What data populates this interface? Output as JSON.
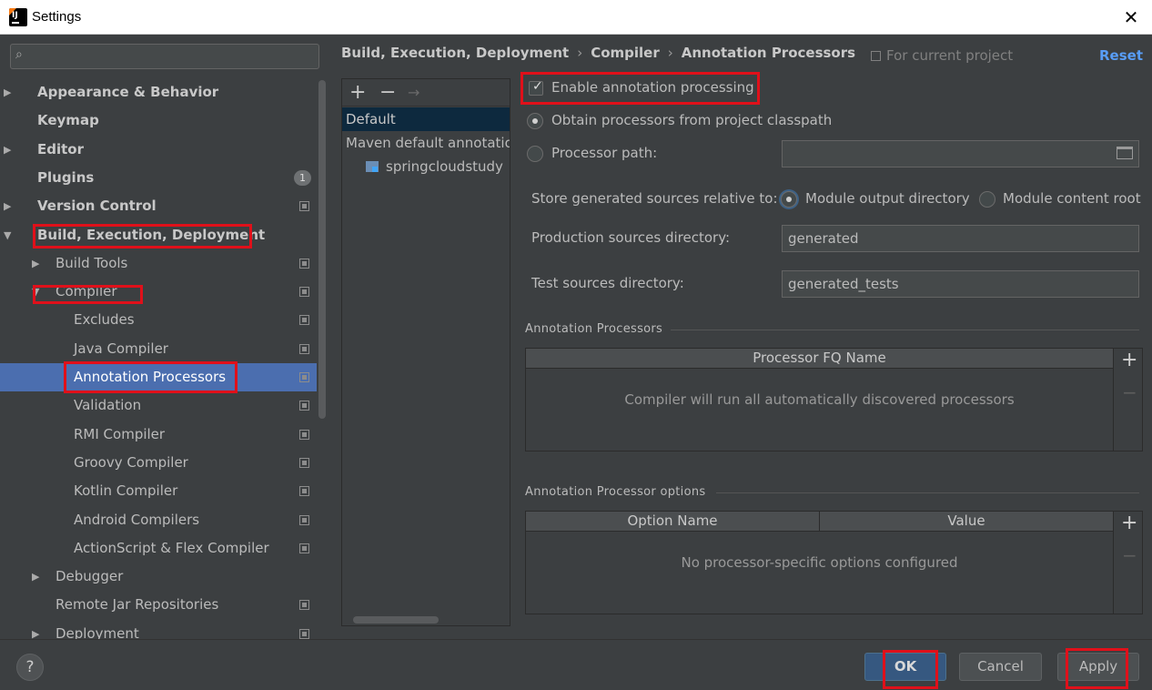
{
  "window": {
    "title": "Settings",
    "close_glyph": "✕",
    "app_icon": "intellij-idea-icon",
    "app_icon_text": "IJ"
  },
  "search": {
    "placeholder": "",
    "icon": "search-icon",
    "glyph": "⌕"
  },
  "sidebar": {
    "items": [
      {
        "label": "Appearance & Behavior",
        "level": 0,
        "arrow": "▶",
        "bold": true
      },
      {
        "label": "Keymap",
        "level": 0,
        "bold": true
      },
      {
        "label": "Editor",
        "level": 0,
        "arrow": "▶",
        "bold": true
      },
      {
        "label": "Plugins",
        "level": 0,
        "bold": true,
        "badge": "1"
      },
      {
        "label": "Version Control",
        "level": 0,
        "arrow": "▶",
        "bold": true,
        "project": true
      },
      {
        "label": "Build, Execution, Deployment",
        "level": 0,
        "arrow": "▼",
        "bold": true
      },
      {
        "label": "Build Tools",
        "level": 1,
        "arrow": "▶",
        "project": true
      },
      {
        "label": "Compiler",
        "level": 1,
        "arrow": "▼",
        "project": true
      },
      {
        "label": "Excludes",
        "level": 2,
        "project": true
      },
      {
        "label": "Java Compiler",
        "level": 2,
        "project": true
      },
      {
        "label": "Annotation Processors",
        "level": 2,
        "project": true,
        "selected": true
      },
      {
        "label": "Validation",
        "level": 2,
        "project": true
      },
      {
        "label": "RMI Compiler",
        "level": 2,
        "project": true
      },
      {
        "label": "Groovy Compiler",
        "level": 2,
        "project": true
      },
      {
        "label": "Kotlin Compiler",
        "level": 2,
        "project": true
      },
      {
        "label": "Android Compilers",
        "level": 2,
        "project": true
      },
      {
        "label": "ActionScript & Flex Compiler",
        "level": 2,
        "project": true
      },
      {
        "label": "Debugger",
        "level": 1,
        "arrow": "▶"
      },
      {
        "label": "Remote Jar Repositories",
        "level": 1,
        "project": true
      },
      {
        "label": "Deployment",
        "level": 1,
        "arrow": "▶",
        "project": true
      }
    ]
  },
  "breadcrumb": {
    "parts": [
      "Build, Execution, Deployment",
      "Compiler",
      "Annotation Processors"
    ],
    "separator": "›"
  },
  "scope": {
    "label": "For current project"
  },
  "reset_label": "Reset",
  "profiles": {
    "toolbar": {
      "add": "+",
      "remove": "−",
      "move": "→"
    },
    "items": [
      {
        "label": "Default",
        "selected": true
      },
      {
        "label": "Maven default annotation processors profile"
      },
      {
        "label": "springcloudstudy",
        "module": true
      }
    ]
  },
  "settings": {
    "enable_label": "Enable annotation processing",
    "enable_checked": true,
    "check_glyph": "✓",
    "obtain_classpath": "Obtain processors from project classpath",
    "processor_path": "Processor path:",
    "processor_path_value": "",
    "store_label": "Store generated sources relative to:",
    "module_output": "Module output directory",
    "module_content": "Module content root",
    "production_label": "Production sources directory:",
    "production_value": "generated",
    "test_label": "Test sources directory:",
    "test_value": "generated_tests"
  },
  "processors_table": {
    "section": "Annotation Processors",
    "header": "Processor FQ Name",
    "empty": "Compiler will run all automatically discovered processors",
    "add": "+",
    "remove": "−"
  },
  "options_table": {
    "section": "Annotation Processor options",
    "col_name": "Option Name",
    "col_value": "Value",
    "empty": "No processor-specific options configured",
    "add": "+",
    "remove": "−"
  },
  "footer": {
    "help": "?",
    "ok": "OK",
    "cancel": "Cancel",
    "apply": "Apply"
  },
  "colors": {
    "selection": "#4b6eaf",
    "highlight": "#e0101a",
    "link": "#589df6",
    "primary": "#365880"
  }
}
